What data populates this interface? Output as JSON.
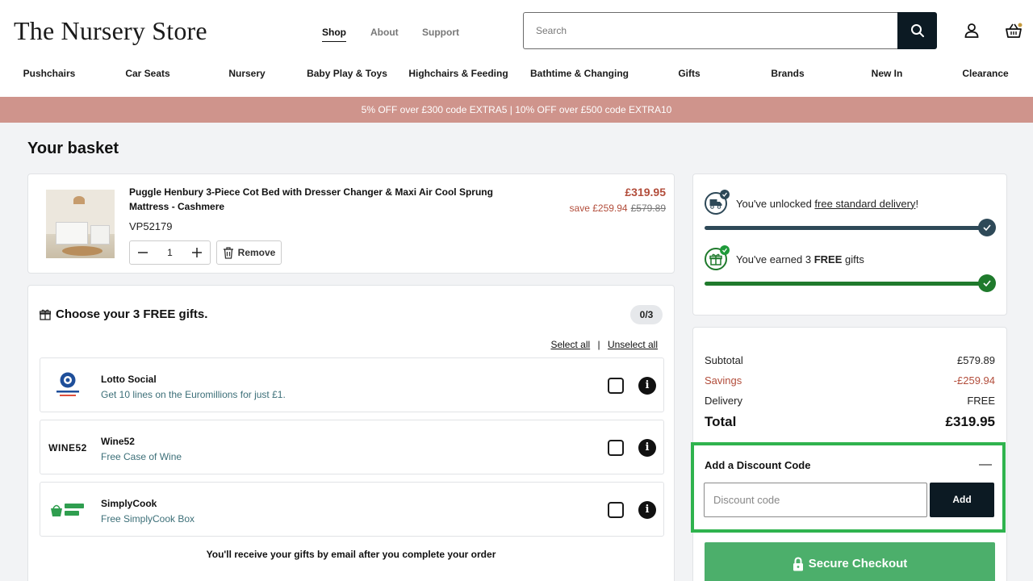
{
  "header": {
    "logo": "The Nursery Store",
    "top_nav": [
      {
        "label": "Shop",
        "active": true
      },
      {
        "label": "About",
        "active": false
      },
      {
        "label": "Support",
        "active": false
      }
    ],
    "search": {
      "placeholder": "Search",
      "value": ""
    },
    "icons": [
      "search-icon",
      "account-icon",
      "basket-icon"
    ]
  },
  "categories": [
    "Pushchairs",
    "Car Seats",
    "Nursery",
    "Baby Play & Toys",
    "Highchairs & Feeding",
    "Bathtime & Changing",
    "Gifts",
    "Brands",
    "New In",
    "Clearance"
  ],
  "promo": "5% OFF over £300 code EXTRA5 | 10% OFF over £500 code EXTRA10",
  "basket": {
    "title": "Your basket",
    "item": {
      "name": "Puggle Henbury 3-Piece Cot Bed with Dresser Changer & Maxi Air Cool Sprung Mattress - Cashmere",
      "sku": "VP52179",
      "quantity": "1",
      "remove_label": "Remove",
      "price": "£319.95",
      "save_label": "save £259.94",
      "was_price": "£579.89"
    }
  },
  "gifts": {
    "title": "Choose your 3 FREE gifts.",
    "count": "0/3",
    "select_all": "Select all",
    "separator": "|",
    "unselect_all": "Unselect all",
    "items": [
      {
        "name": "Lotto Social",
        "desc": "Get 10 lines on the Euromillions for just £1.",
        "logo": "lotto-social-logo",
        "checked": false
      },
      {
        "name": "Wine52",
        "desc": "Free Case of Wine",
        "logo": "wine52-logo",
        "logo_text": "WINE52",
        "checked": false
      },
      {
        "name": "SimplyCook",
        "desc": "Free SimplyCook Box",
        "logo": "simplycook-logo",
        "checked": false
      }
    ],
    "note": "You'll receive your gifts by email after you complete your order"
  },
  "progress": {
    "delivery": {
      "prefix": "You've unlocked ",
      "link": "free standard delivery",
      "suffix": "!",
      "level": 1.0,
      "color": "#2e4958"
    },
    "gifts": {
      "prefix": "You've earned 3 ",
      "bold": "FREE",
      "suffix": " gifts",
      "level": 1.0,
      "color": "#1f7a2c"
    }
  },
  "summary": {
    "subtotal_label": "Subtotal",
    "subtotal": "£579.89",
    "savings_label": "Savings",
    "savings": "-£259.94",
    "delivery_label": "Delivery",
    "delivery": "FREE",
    "total_label": "Total",
    "total": "£319.95"
  },
  "discount": {
    "title": "Add a Discount Code",
    "toggle": "—",
    "placeholder": "Discount code",
    "value": "",
    "button": "Add"
  },
  "checkout": {
    "label": "Secure Checkout"
  },
  "colors": {
    "accent_dark": "#0c1a23",
    "promo": "#cf948c",
    "sale": "#b24d3b",
    "highlight": "#2fb34e",
    "checkout": "#4caf6b"
  }
}
